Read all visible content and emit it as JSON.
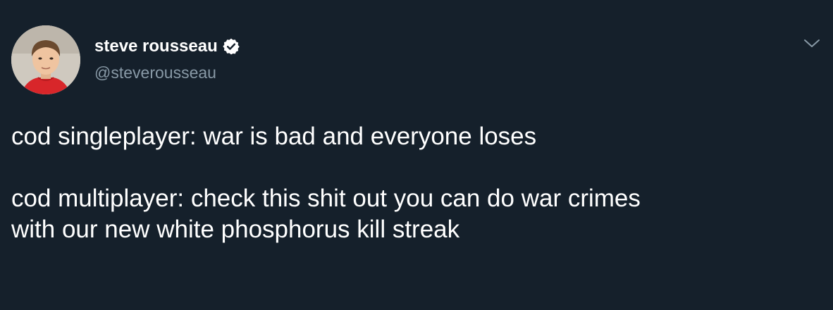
{
  "tweet": {
    "author": {
      "display_name": "steve rousseau",
      "handle": "@steverousseau",
      "verified": true,
      "verified_icon": "verified-badge-icon",
      "avatar": "avatar"
    },
    "menu_icon": "chevron-down-icon",
    "text": {
      "line1": "cod singleplayer: war is bad and everyone loses",
      "line2": "cod multiplayer: check this shit out you can do war crimes",
      "line3": "with our new white phosphorus kill streak"
    }
  },
  "colors": {
    "background": "#15202b",
    "primary_text": "#ffffff",
    "secondary_text": "#8899a6"
  }
}
